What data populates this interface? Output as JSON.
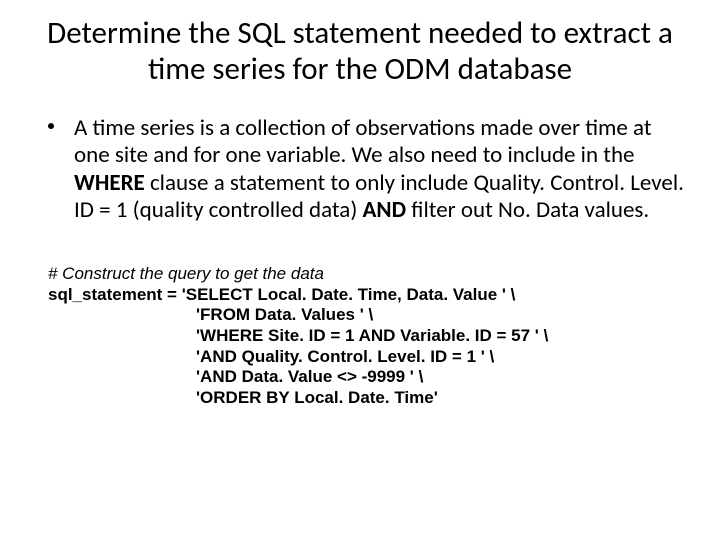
{
  "title": "Determine the SQL statement needed to extract a time series for the ODM database",
  "bullet": {
    "part1": "A time series is a collection of observations made over time at one site and for one variable. We also need to include in the ",
    "where": "WHERE",
    "part2": " clause a statement to only include Quality. Control. Level. ID = 1 (quality controlled data) ",
    "and": "AND",
    "part3": " filter out No. Data values."
  },
  "code": {
    "comment": "# Construct the query to get the data",
    "line1": "sql_statement = 'SELECT Local. Date. Time, Data. Value ' \\",
    "line2": "'FROM Data. Values ' \\",
    "line3": "'WHERE Site. ID = 1 AND Variable. ID = 57 ' \\",
    "line4": "'AND Quality. Control. Level. ID = 1 ' \\",
    "line5": "'AND Data. Value <> -9999 ' \\",
    "line6": "'ORDER BY Local. Date. Time'"
  }
}
